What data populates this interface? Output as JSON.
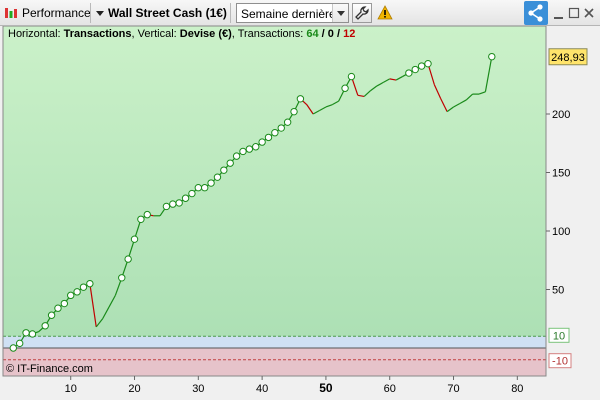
{
  "toolbar": {
    "performance_label": "Performance",
    "instrument_label": "Wall Street Cash (1€)",
    "period_value": "Semaine dernière",
    "settings_icon": "wrench-icon",
    "warning_icon": "warning-icon",
    "share_icon": "share-icon",
    "window_icons": [
      "minimize-icon",
      "maximize-icon",
      "close-icon"
    ],
    "share_color": "#3a8fd8",
    "warning_color": "#f0b400"
  },
  "legend": {
    "prefix": "Horizontal: ",
    "horizontal_value": "Transactions",
    "mid": ", Vertical: ",
    "vertical_value": "Devise (€)",
    "trans_label": ", Transactions: ",
    "wins": "64",
    "slash1": " / ",
    "neutral": "0",
    "slash2": " / ",
    "losses": "12",
    "win_color": "#1a8a1a",
    "loss_color": "#c00000"
  },
  "watermark": "© IT-Finance.com",
  "chart_data": {
    "type": "line",
    "title": "",
    "xlabel": "Transactions",
    "ylabel": "Devise (€)",
    "xlim": [
      1,
      85
    ],
    "ylim": [
      -15,
      265
    ],
    "x_ticks": [
      "10",
      "20",
      "30",
      "40",
      "50",
      "60",
      "70",
      "80"
    ],
    "x_tick_values": [
      10,
      20,
      30,
      40,
      50,
      60,
      70,
      80
    ],
    "x_tick_bold": "50",
    "y_ticks": [
      "50",
      "100",
      "150",
      "200"
    ],
    "y_tick_values": [
      50,
      100,
      150,
      200
    ],
    "last_value_label": "248,93",
    "last_value": 248.93,
    "upper_threshold_label": "10",
    "upper_threshold": 10,
    "lower_threshold_label": "-10",
    "lower_threshold": -10,
    "win_color": "#1a8a1a",
    "loss_color": "#c00000",
    "series": [
      {
        "x": [
          1,
          2,
          3,
          4,
          5,
          6,
          7,
          8,
          9,
          10,
          11,
          12,
          13,
          14,
          15,
          16,
          17,
          18,
          19,
          20,
          21,
          22,
          23,
          24,
          25,
          26,
          27,
          28,
          29,
          30,
          31,
          32,
          33,
          34,
          35,
          36,
          37,
          38,
          39,
          40,
          41,
          42,
          43,
          44,
          45,
          46,
          47,
          48,
          49,
          50,
          51,
          52,
          53,
          54,
          55,
          56,
          57,
          58,
          59,
          60,
          61,
          62,
          63,
          64,
          65,
          66,
          67,
          68,
          69,
          70,
          71,
          72,
          73,
          74,
          75,
          76
        ],
        "values": [
          0,
          4,
          13,
          12,
          14,
          19,
          28,
          34,
          38,
          45,
          48,
          52,
          55,
          18,
          25,
          35,
          45,
          60,
          76,
          93,
          110,
          114,
          113,
          113,
          121,
          123,
          124,
          128,
          132,
          137,
          137,
          141,
          146,
          152,
          158,
          164,
          168,
          170,
          172,
          176,
          180,
          184,
          188,
          193,
          202,
          213,
          208,
          200,
          203,
          206,
          208,
          211,
          222,
          232,
          216,
          215,
          220,
          224,
          227,
          230,
          229,
          232,
          235,
          238,
          241,
          243,
          225,
          213,
          202,
          206,
          209,
          212,
          217,
          217,
          219,
          249
        ],
        "markers": [
          1,
          1,
          1,
          1,
          0,
          1,
          1,
          1,
          1,
          1,
          1,
          1,
          1,
          0,
          0,
          0,
          0,
          1,
          1,
          1,
          1,
          1,
          0,
          0,
          1,
          1,
          1,
          1,
          1,
          1,
          1,
          1,
          1,
          1,
          1,
          1,
          1,
          1,
          1,
          1,
          1,
          1,
          1,
          1,
          1,
          1,
          0,
          0,
          0,
          0,
          0,
          0,
          1,
          1,
          0,
          0,
          0,
          0,
          0,
          0,
          0,
          0,
          1,
          1,
          1,
          1,
          0,
          0,
          0,
          0,
          0,
          0,
          0,
          0,
          0,
          1
        ]
      }
    ]
  }
}
